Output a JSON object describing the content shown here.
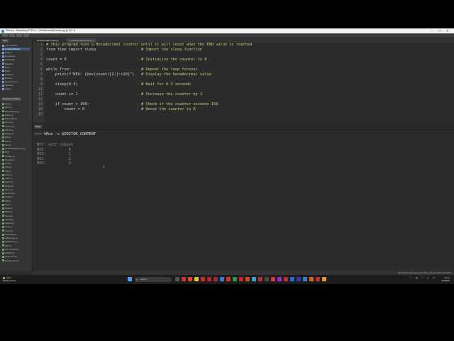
{
  "window": {
    "title": "Thonny - Raspberry Pi Pico :: /HexDecimalCounter.py @ 15 : 8",
    "controls": [
      "–",
      "□",
      "✕"
    ]
  },
  "sidebar": {
    "pane_label": "Files",
    "section_label": "Raspberry Pi Pico",
    "files": [
      "This computer",
      "C:\\Users\\Pi\\Desk",
      "Arduino",
      "Documents",
      "Downloads",
      "Favorites",
      "Links",
      "Music",
      "OneDrive",
      "Pictures",
      "Saved Games",
      "Searches",
      "Videos",
      "boot.py",
      "blink.py",
      "BluetoothLed.py",
      "Button.py",
      "ButtonLED.py",
      "buzzer.py",
      "Counter.py",
      "DHT11.py",
      "Display.py",
      "Dist.py",
      "Fan.py",
      "Gas.py",
      "HexDecimalCounter.py",
      "IR.py",
      "Joystick.py",
      "Keypad.py",
      "LCD.py",
      "LDR.py",
      "LED.py",
      "Light.py",
      "main.py",
      "Matrix.py",
      "Motion.py",
      "Motor.py",
      "Neopixel.py",
      "OLED.py",
      "PIR.py",
      "Pot.py",
      "Relay.py",
      "RFID.py",
      "Servo.py",
      "Sound.py",
      "Stepper.py",
      "Temp.py",
      "Touch.py",
      "Ultrasonic.py",
      "WaterLevel.py",
      "WebServer.py",
      "WiFi.py",
      "wifi_connect.py",
      "ws2812.py",
      "xmas_tree.py",
      "ZeroCounter.py"
    ],
    "selected_index": 1
  },
  "tabs": [
    "HexDecimalCounter.py",
    "[ HexDecimalCounter.py ]"
  ],
  "editor": {
    "lines": [
      {
        "n": "1",
        "code": "# This program runs a Hexadecimal counter until it will reset when the END value is reached",
        "comment": ""
      },
      {
        "n": "2",
        "code": "from time import sleep",
        "comment": "# Import the sleep function"
      },
      {
        "n": "3",
        "code": "",
        "comment": ""
      },
      {
        "n": "4",
        "code": "count = 0",
        "comment": "# Initialize the counter to 0"
      },
      {
        "n": "5",
        "code": "",
        "comment": ""
      },
      {
        "n": "6",
        "code": "while True:",
        "comment": "# Repeat the loop forever"
      },
      {
        "n": "7",
        "code": "    print(f\"HEX: {hex(count)[2:]:>10}\")",
        "comment": "# Display the hexadecimal value"
      },
      {
        "n": "8",
        "code": "",
        "comment": ""
      },
      {
        "n": "9",
        "code": "    sleep(0.3)",
        "comment": "# Wait for 0.3 seconds"
      },
      {
        "n": "10",
        "code": "",
        "comment": ""
      },
      {
        "n": "11",
        "code": "    count += 1",
        "comment": "# Increase the counter by 1"
      },
      {
        "n": "12",
        "code": "",
        "comment": ""
      },
      {
        "n": "13",
        "code": "    if count > 150:",
        "comment": "# Check if the counter exceeds 150"
      },
      {
        "n": "14",
        "code": "        count = 0",
        "comment": "# Reset the counter to 0"
      },
      {
        "n": "15",
        "code": "",
        "comment": ""
      }
    ]
  },
  "shell": {
    "label": "Shell",
    "prompt": ">>>",
    "command": "%Run -c $EDITOR_CONTENT",
    "output": [
      "MPY: soft reboot",
      "HEX:          0",
      "HEX:          1",
      "HEX:          2",
      "HEX:          3"
    ]
  },
  "statusbar": {
    "text": "MicroPython (Raspberry Pi Pico) • Board CDC @ COM7"
  },
  "taskbar": {
    "weather_temp": "19°C",
    "weather_desc": "Mostly cloudy",
    "search_placeholder": "Search",
    "time": "14:43",
    "date": "2/1/2025"
  },
  "colors": {
    "editor_bg": "#2b2b2b",
    "comment": "#cfcf7a",
    "code": "#d8d8d8",
    "shell_output": "#8a8a8a",
    "prompt": "#7ab0e0"
  }
}
